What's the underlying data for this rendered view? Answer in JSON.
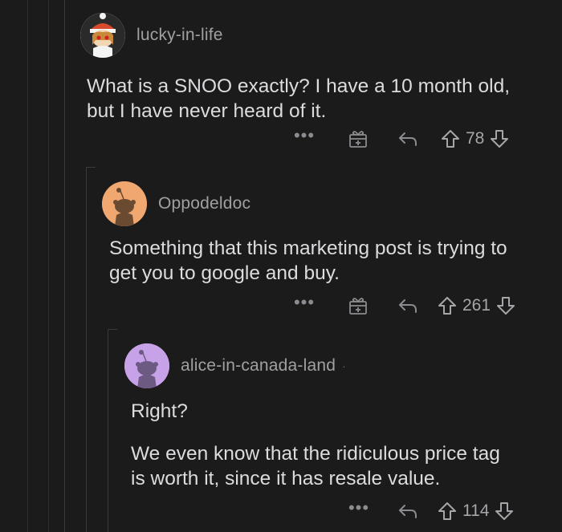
{
  "comments": [
    {
      "username": "lucky-in-life",
      "lines": [
        "What is a SNOO exactly? I have a 10 month old,",
        "but I have never heard of it."
      ],
      "votes": "78",
      "avatar": "anime-girl-avatar"
    },
    {
      "username": "Oppodeldoc",
      "lines": [
        "Something that this marketing post is trying to",
        "get you to google and buy."
      ],
      "votes": "261",
      "avatar": "snoo-avatar-orange"
    },
    {
      "username": "alice-in-canada-land",
      "username_suffix": "·",
      "paragraph1": "Right?",
      "lines": [
        "We even know that the ridiculous price tag",
        "is worth it, since it has resale value."
      ],
      "votes": "114",
      "avatar": "snoo-avatar-purple"
    }
  ],
  "actions": {
    "more": "•••"
  },
  "icons": [
    "more-options-icon",
    "award-icon",
    "reply-icon",
    "upvote-icon",
    "downvote-icon"
  ],
  "colors": {
    "background": "#1b1b1b",
    "text": "#dcdcdf",
    "muted": "#a0a0a3",
    "avatar_orange": "#f0a870",
    "avatar_purple": "#c8a2e8"
  }
}
